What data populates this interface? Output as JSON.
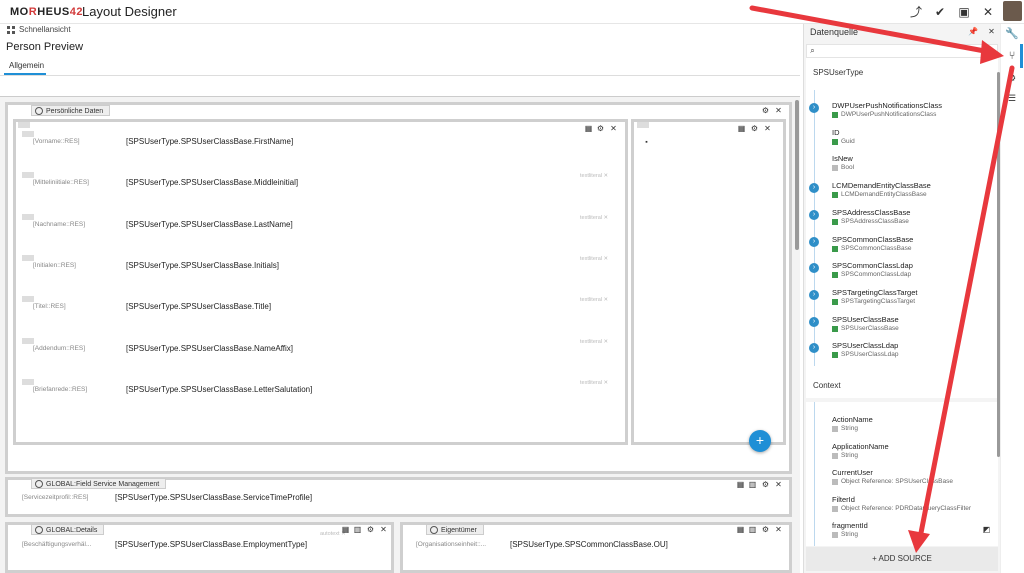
{
  "app": {
    "logo_pre": "MO",
    "logo_accent": "R",
    "logo_post": "HEUS",
    "logo_num": "42",
    "title": "Layout Designer"
  },
  "subbar": {
    "quick_label": "Schnellansicht"
  },
  "page": {
    "title": "Person Preview",
    "tabs": [
      "Allgemein"
    ]
  },
  "sections": {
    "personal": {
      "title": "Persönliche Daten",
      "rows": [
        {
          "res": "[Vorname::RES]",
          "value": "[SPSUserType.SPSUserClassBase.FirstName]",
          "tag": ""
        },
        {
          "res": "[Mitteliniitiale::RES]",
          "value": "[SPSUserType.SPSUserClassBase.Middleinitial]",
          "tag": "textliteral"
        },
        {
          "res": "[Nachname::RES]",
          "value": "[SPSUserType.SPSUserClassBase.LastName]",
          "tag": "textliteral"
        },
        {
          "res": "[Initialen::RES]",
          "value": "[SPSUserType.SPSUserClassBase.Initials]",
          "tag": "textliteral"
        },
        {
          "res": "[Titel::RES]",
          "value": "[SPSUserType.SPSUserClassBase.Title]",
          "tag": "textliteral"
        },
        {
          "res": "[Addendum::RES]",
          "value": "[SPSUserType.SPSUserClassBase.NameAffix]",
          "tag": "textliteral"
        },
        {
          "res": "[Briefanrede::RES]",
          "value": "[SPSUserType.SPSUserClassBase.LetterSalutation]",
          "tag": "textliteral"
        }
      ]
    },
    "fsm": {
      "title": "GLOBAL:Field Service Management",
      "res": "[Servicezeitprofil::RES]",
      "value": "[SPSUserType.SPSUserClassBase.ServiceTimeProfile]"
    },
    "details": {
      "title": "GLOBAL:Details",
      "res": "[Beschäftigungsverhäl...",
      "value": "[SPSUserType.SPSUserClassBase.EmploymentType]",
      "tag": "autotext"
    },
    "owner": {
      "title": "Eigentümer",
      "res": "[Organisationseinheit::...",
      "value": "[SPSUserType.SPSCommonClassBase.OU]"
    }
  },
  "datasource": {
    "title": "Datenquelle",
    "search_placeholder": "",
    "group1": "SPSUserType",
    "nodes1": [
      {
        "name": "DWPUserPushNotificationsClass",
        "type": "DWPUserPushNotificationsClass",
        "expand": true,
        "color": "#3a9a4a"
      },
      {
        "name": "ID",
        "type": "Guid",
        "expand": false,
        "color": "#3a9a4a"
      },
      {
        "name": "IsNew",
        "type": "Bool",
        "expand": false,
        "color": "#bbbbbb"
      },
      {
        "name": "LCMDemandEntityClassBase",
        "type": "LCMDemandEntityClassBase",
        "expand": true,
        "color": "#3a9a4a"
      },
      {
        "name": "SPSAddressClassBase",
        "type": "SPSAddressClassBase",
        "expand": true,
        "color": "#3a9a4a"
      },
      {
        "name": "SPSCommonClassBase",
        "type": "SPSCommonClassBase",
        "expand": true,
        "color": "#3a9a4a"
      },
      {
        "name": "SPSCommonClassLdap",
        "type": "SPSCommonClassLdap",
        "expand": true,
        "color": "#3a9a4a"
      },
      {
        "name": "SPSTargetingClassTarget",
        "type": "SPSTargetingClassTarget",
        "expand": true,
        "color": "#3a9a4a"
      },
      {
        "name": "SPSUserClassBase",
        "type": "SPSUserClassBase",
        "expand": true,
        "color": "#3a9a4a"
      },
      {
        "name": "SPSUserClassLdap",
        "type": "SPSUserClassLdap",
        "expand": true,
        "color": "#3a9a4a"
      }
    ],
    "group2": "Context",
    "nodes2": [
      {
        "name": "ActionName",
        "type": "String",
        "expand": false,
        "color": "#bbbbbb"
      },
      {
        "name": "ApplicationName",
        "type": "String",
        "expand": false,
        "color": "#bbbbbb"
      },
      {
        "name": "CurrentUser",
        "type": "Object Reference: SPSUserClassBase",
        "expand": false,
        "color": "#bbbbbb"
      },
      {
        "name": "FilterId",
        "type": "Object Reference: PDRDataQueryClassFilter",
        "expand": false,
        "color": "#bbbbbb"
      },
      {
        "name": "fragmentId",
        "type": "String",
        "expand": false,
        "color": "#bbbbbb"
      }
    ],
    "add_source": "+  ADD SOURCE"
  },
  "icons": {
    "share": "share-icon",
    "check": "double-check-icon",
    "save": "save-icon",
    "close": "close-icon",
    "pin": "pin-icon",
    "wrench": "wrench-icon",
    "hierarchy": "hierarchy-icon"
  },
  "colors": {
    "accent": "#1f8fd6",
    "arrow": "#e8383d",
    "logo_red": "#d23a3a"
  },
  "fab_label": "+"
}
